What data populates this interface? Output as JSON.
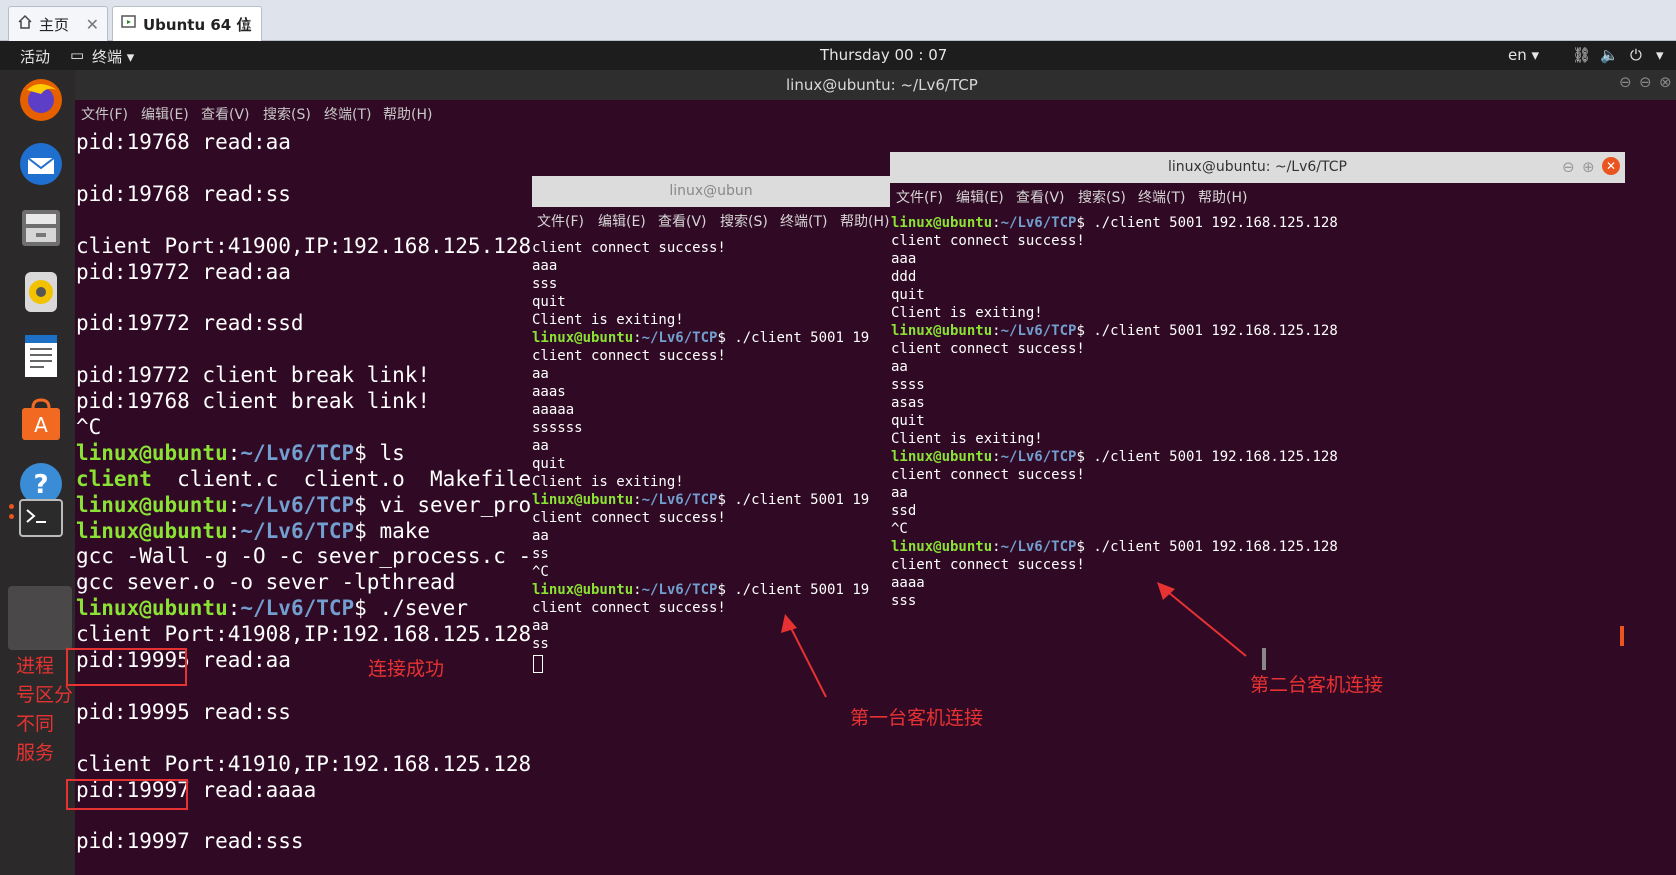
{
  "vm_tabs": [
    {
      "label": "主页",
      "icon": "home-icon"
    },
    {
      "label": "Ubuntu 64 位",
      "icon": "vm-icon"
    }
  ],
  "topbar": {
    "activities": "活动",
    "app_menu": "终端 ▾",
    "clock": "Thursday 00 : 07",
    "lang": "en ▾"
  },
  "dock": [
    "firefox-icon",
    "thunderbird-icon",
    "files-icon",
    "rhythmbox-icon",
    "writer-icon",
    "software-icon",
    "help-icon",
    "terminal-icon"
  ],
  "main_window": {
    "title": "linux@ubuntu: ~/Lv6/TCP",
    "menu": [
      "文件(F)",
      "编辑(E)",
      "查看(V)",
      "搜索(S)",
      "终端(T)",
      "帮助(H)"
    ],
    "lines": [
      {
        "t": "pid:19768 read:aa"
      },
      {
        "t": ""
      },
      {
        "t": "pid:19768 read:ss"
      },
      {
        "t": ""
      },
      {
        "t": "client Port:41900,IP:192.168.125.128"
      },
      {
        "t": "pid:19772 read:aa"
      },
      {
        "t": ""
      },
      {
        "t": "pid:19772 read:ssd"
      },
      {
        "t": ""
      },
      {
        "t": "pid:19772 client break link!"
      },
      {
        "t": "pid:19768 client break link!"
      },
      {
        "t": "^C"
      },
      {
        "prompt": true,
        "cmd": " ls"
      },
      {
        "ls": true,
        "exe": "client",
        "rest": "  client.c  client.o  Makefile"
      },
      {
        "prompt": true,
        "cmd": " vi sever_proce"
      },
      {
        "prompt": true,
        "cmd": " make"
      },
      {
        "t": "gcc -Wall -g -O -c sever_process.c -o"
      },
      {
        "t": "gcc sever.o -o sever -lpthread"
      },
      {
        "prompt": true,
        "cmd": " ./sever"
      },
      {
        "t": "client Port:41908,IP:192.168.125.128"
      },
      {
        "t": "pid:19995 read:aa"
      },
      {
        "t": ""
      },
      {
        "t": "pid:19995 read:ss"
      },
      {
        "t": ""
      },
      {
        "t": "client Port:41910,IP:192.168.125.128"
      },
      {
        "t": "pid:19997 read:aaaa"
      },
      {
        "t": ""
      },
      {
        "t": "pid:19997 read:sss"
      }
    ]
  },
  "prompt": {
    "user": "linux@ubuntu",
    "sep": ":",
    "path": "~/Lv6/TCP",
    "dollar": "$"
  },
  "window2": {
    "title": "linux@ubun",
    "menu": [
      "文件(F)",
      "编辑(E)",
      "查看(V)",
      "搜索(S)",
      "终端(T)",
      "帮助(H)"
    ],
    "lines": [
      {
        "t": "client connect success!"
      },
      {
        "t": "aaa"
      },
      {
        "t": "sss"
      },
      {
        "t": "quit"
      },
      {
        "t": "Client is exiting!"
      },
      {
        "prompt": true,
        "cmd": " ./client 5001 19"
      },
      {
        "t": "client connect success!"
      },
      {
        "t": "aa"
      },
      {
        "t": "aaas"
      },
      {
        "t": "aaaaa"
      },
      {
        "t": "ssssss"
      },
      {
        "t": "aa"
      },
      {
        "t": "quit"
      },
      {
        "t": "Client is exiting!"
      },
      {
        "prompt": true,
        "cmd": " ./client 5001 19"
      },
      {
        "t": "client connect success!"
      },
      {
        "t": "aa"
      },
      {
        "t": "ss"
      },
      {
        "t": "^C"
      },
      {
        "prompt": true,
        "cmd": " ./client 5001 19"
      },
      {
        "t": "client connect success!"
      },
      {
        "t": "aa"
      },
      {
        "t": "ss"
      }
    ]
  },
  "window3": {
    "title": "linux@ubuntu: ~/Lv6/TCP",
    "menu": [
      "文件(F)",
      "编辑(E)",
      "查看(V)",
      "搜索(S)",
      "终端(T)",
      "帮助(H)"
    ],
    "lines": [
      {
        "prompt": true,
        "cmd": " ./client 5001 192.168.125.128"
      },
      {
        "t": "client connect success!"
      },
      {
        "t": "aaa"
      },
      {
        "t": "ddd"
      },
      {
        "t": "quit"
      },
      {
        "t": "Client is exiting!"
      },
      {
        "prompt": true,
        "cmd": " ./client 5001 192.168.125.128"
      },
      {
        "t": "client connect success!"
      },
      {
        "t": "aa"
      },
      {
        "t": "ssss"
      },
      {
        "t": "asas"
      },
      {
        "t": "quit"
      },
      {
        "t": "Client is exiting!"
      },
      {
        "prompt": true,
        "cmd": " ./client 5001 192.168.125.128"
      },
      {
        "t": "client connect success!"
      },
      {
        "t": "aa"
      },
      {
        "t": "ssd"
      },
      {
        "t": "^C"
      },
      {
        "prompt": true,
        "cmd": " ./client 5001 192.168.125.128"
      },
      {
        "t": "client connect success!"
      },
      {
        "t": "aaaa"
      },
      {
        "t": "sss"
      }
    ]
  },
  "annotations": {
    "left_note": [
      "进程",
      "号区分",
      "不同",
      "服务"
    ],
    "success": "连接成功",
    "first_client": "第一台客机连接",
    "second_client": "第二台客机连接"
  },
  "colors": {
    "terminal_bg": "#300a24",
    "prompt_green": "#8ae234",
    "prompt_blue": "#729fcf",
    "annotation_red": "#e63232"
  }
}
